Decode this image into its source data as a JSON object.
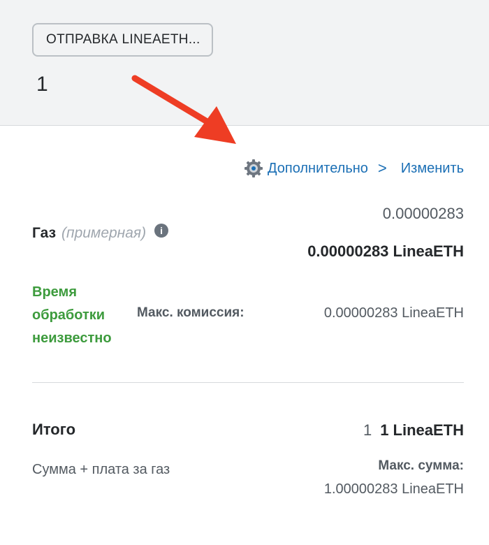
{
  "header": {
    "send_label": "ОТПРАВКА LINEAETH...",
    "amount": "1"
  },
  "advanced": {
    "label": "Дополнительно",
    "chevron": ">",
    "edit_label": "Изменить",
    "icon": "gear-icon"
  },
  "gas": {
    "label": "Газ",
    "approx": "(примерная)",
    "info_icon": "i",
    "fiat_value": "0.00000283",
    "value_bold": "0.00000283 LineaETH",
    "time_unknown": "Время обработки неизвестно",
    "max_fee_label": "Макс. комиссия:",
    "max_fee_value": "0.00000283 LineaETH"
  },
  "total": {
    "label": "Итого",
    "small_value": "1",
    "bold_value": "1 LineaETH",
    "desc": "Сумма + плата за газ",
    "max_sum_label": "Макс. сумма:",
    "max_sum_value": "1.00000283 LineaETH"
  },
  "colors": {
    "link": "#1b6fb5",
    "success": "#3d9b3d",
    "arrow": "#ee3d24"
  }
}
